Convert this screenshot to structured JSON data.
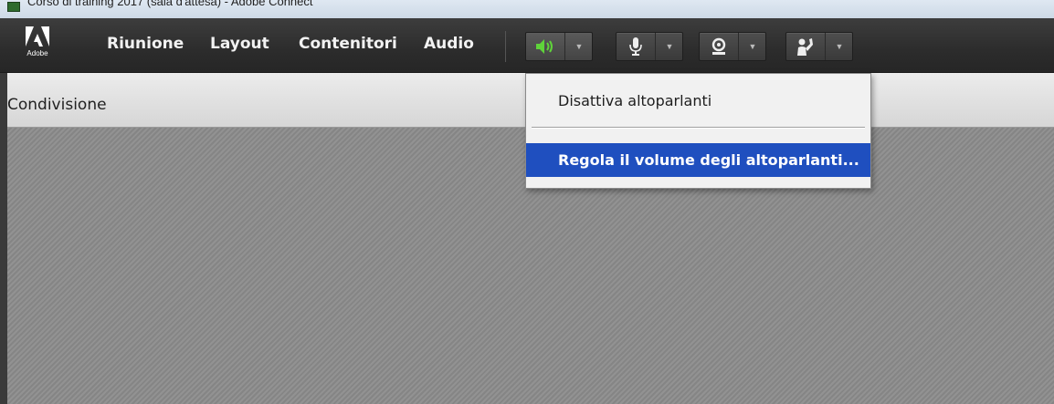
{
  "window": {
    "title": "Corso di training 2017 (sala d'attesa) - Adobe Connect"
  },
  "menubar": {
    "logo_text": "Adobe",
    "items": [
      {
        "label": "Riunione"
      },
      {
        "label": "Layout"
      },
      {
        "label": "Contenitori"
      },
      {
        "label": "Audio"
      }
    ],
    "tools": [
      {
        "icon": "speaker-icon",
        "active": true,
        "color": "#5fd33a"
      },
      {
        "icon": "microphone-icon",
        "active": false
      },
      {
        "icon": "webcam-icon",
        "active": false
      },
      {
        "icon": "raise-hand-icon",
        "active": false
      }
    ]
  },
  "pod": {
    "title": "Condivisione"
  },
  "speaker_menu": {
    "items": [
      {
        "label": "Disattiva altoparlanti",
        "selected": false
      },
      {
        "label": "Regola il volume degli altoparlanti...",
        "selected": true
      }
    ],
    "highlight_color": "#1f4fbf"
  }
}
